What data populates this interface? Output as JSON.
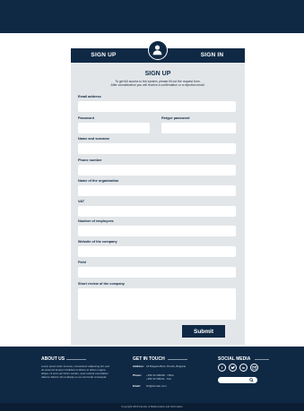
{
  "tabs": {
    "signup": "SIGN UP",
    "signin": "SIGN IN"
  },
  "form": {
    "title": "SIGN UP",
    "description_line1": "To get full access to the system, please fill out the request form.",
    "description_line2": "After consideration you will receive a confirmation or a rejection email.",
    "labels": {
      "email": "Email address",
      "password": "Password",
      "retype_password": "Retype password",
      "name": "Name and surname",
      "phone": "Phone number",
      "organization": "Name of the organization",
      "vat": "VAT",
      "employees": "Number of employees",
      "website": "Website of the company",
      "field": "Field",
      "review": "Short review of the company"
    },
    "submit_label": "Submit"
  },
  "footer": {
    "about": {
      "heading": "ABOUT US",
      "text": "Lorem ipsum dolor sit amet, consectetur adipiscing elit, sed do eiusmod tempor incididunt ut labore et dolore magna aliqua. Ut enim ad minim veniam, quis nostrud exercitation ullamco laboris nisi ut aliquip ex ea commodo consequat."
    },
    "contact": {
      "heading": "GET IN TOUCH",
      "address_key": "Address:",
      "address_val": "24 Bulgaria Blvd, Plovdiv, Bulgaria",
      "phone_key": "Phone:",
      "phone_val1": "+359 32 000000 - Office",
      "phone_val2": "+359 32 000111 - Fax",
      "email_key": "Email:",
      "email_val": "fmi@domain.com"
    },
    "social": {
      "heading": "SOCIAL MEDIA",
      "icons": [
        "facebook-icon",
        "twitter-icon",
        "linkedin-icon",
        "email-icon"
      ]
    },
    "copyright": "Copyright 2019 Faculty of Mathematics and Informatics"
  }
}
